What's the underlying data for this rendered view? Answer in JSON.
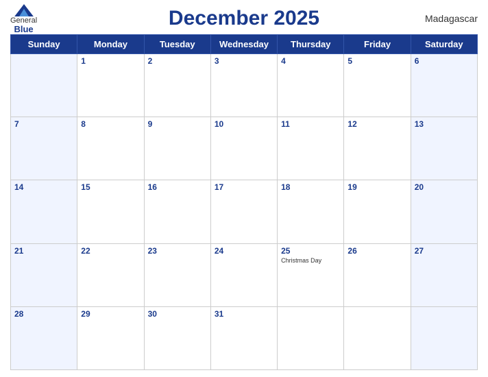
{
  "header": {
    "title": "December 2025",
    "logo_general": "General",
    "logo_blue": "Blue",
    "country": "Madagascar"
  },
  "weekdays": [
    "Sunday",
    "Monday",
    "Tuesday",
    "Wednesday",
    "Thursday",
    "Friday",
    "Saturday"
  ],
  "weeks": [
    [
      {
        "day": "",
        "holiday": ""
      },
      {
        "day": "1",
        "holiday": ""
      },
      {
        "day": "2",
        "holiday": ""
      },
      {
        "day": "3",
        "holiday": ""
      },
      {
        "day": "4",
        "holiday": ""
      },
      {
        "day": "5",
        "holiday": ""
      },
      {
        "day": "6",
        "holiday": ""
      }
    ],
    [
      {
        "day": "7",
        "holiday": ""
      },
      {
        "day": "8",
        "holiday": ""
      },
      {
        "day": "9",
        "holiday": ""
      },
      {
        "day": "10",
        "holiday": ""
      },
      {
        "day": "11",
        "holiday": ""
      },
      {
        "day": "12",
        "holiday": ""
      },
      {
        "day": "13",
        "holiday": ""
      }
    ],
    [
      {
        "day": "14",
        "holiday": ""
      },
      {
        "day": "15",
        "holiday": ""
      },
      {
        "day": "16",
        "holiday": ""
      },
      {
        "day": "17",
        "holiday": ""
      },
      {
        "day": "18",
        "holiday": ""
      },
      {
        "day": "19",
        "holiday": ""
      },
      {
        "day": "20",
        "holiday": ""
      }
    ],
    [
      {
        "day": "21",
        "holiday": ""
      },
      {
        "day": "22",
        "holiday": ""
      },
      {
        "day": "23",
        "holiday": ""
      },
      {
        "day": "24",
        "holiday": ""
      },
      {
        "day": "25",
        "holiday": "Christmas Day"
      },
      {
        "day": "26",
        "holiday": ""
      },
      {
        "day": "27",
        "holiday": ""
      }
    ],
    [
      {
        "day": "28",
        "holiday": ""
      },
      {
        "day": "29",
        "holiday": ""
      },
      {
        "day": "30",
        "holiday": ""
      },
      {
        "day": "31",
        "holiday": ""
      },
      {
        "day": "",
        "holiday": ""
      },
      {
        "day": "",
        "holiday": ""
      },
      {
        "day": "",
        "holiday": ""
      }
    ]
  ]
}
